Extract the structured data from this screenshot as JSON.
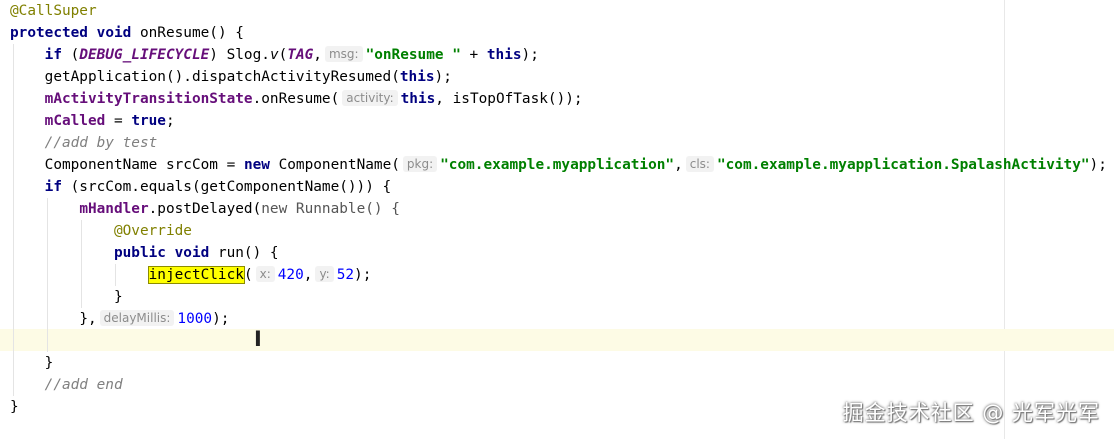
{
  "editor": {
    "watermark": "掘金技术社区 @ 光军光军",
    "lines": {
      "l01": {
        "annotation": "@CallSuper"
      },
      "l02": {
        "kw_protected": "protected",
        "kw_void": "void",
        "method_decl": " onResume() {"
      },
      "l03": {
        "kw_if": "if",
        "open": " (",
        "const": "DEBUG_LIFECYCLE",
        "mid": ") Slog.",
        "v": "v",
        "paren": "(",
        "tag": "TAG",
        "comma": ",",
        "hint": "msg:",
        "str": "\"onResume \"",
        "plus": " + ",
        "kw_this": "this",
        "close": ");"
      },
      "l04": {
        "code": "getApplication().dispatchActivityResumed(",
        "kw_this": "this",
        "close": ");"
      },
      "l05": {
        "field": "mActivityTransitionState",
        "code": ".onResume(",
        "hint": "activity:",
        "kw_this": "this",
        "rest": ", isTopOfTask());"
      },
      "l06": {
        "field": "mCalled",
        "eq": " = ",
        "kw_true": "true",
        "semi": ";"
      },
      "l07": {
        "comment": "//add by test"
      },
      "l08": {
        "code": "ComponentName srcCom = ",
        "kw_new": "new",
        "ctor": " ComponentName(",
        "hint_pkg": "pkg:",
        "str_pkg": "\"com.example.myapplication\"",
        "comma": ",",
        "hint_cls": "cls:",
        "str_cls": "\"com.example.myapplication.SpalashActivity\"",
        "close": ");"
      },
      "l09": {
        "kw_if": "if",
        "code": " (srcCom.equals(getComponentName())) {"
      },
      "l10": {
        "field": "mHandler",
        "code": ".postDelayed(",
        "muted_new": "new",
        "muted_rest": " Runnable() {"
      },
      "l11": {
        "annotation": "@Override"
      },
      "l12": {
        "kw_public": "public",
        "kw_void": "void",
        "code": " run() {"
      },
      "l13": {
        "call": "injectClick",
        "paren": "(",
        "hint_x": "x:",
        "num_x": "420",
        "comma": ",",
        "hint_y": "y:",
        "num_y": "52",
        "close": ");"
      },
      "l14": {
        "code": "}"
      },
      "l15": {
        "code": "},",
        "hint": "delayMillis:",
        "num": "1000",
        "close": ");"
      },
      "l16": {
        "code": ""
      },
      "l17": {
        "code": "}"
      },
      "l18": {
        "comment": "//add end"
      },
      "l19": {
        "code": "}"
      }
    },
    "colors": {
      "keyword": "#000080",
      "string": "#008000",
      "number": "#0000ff",
      "annotation": "#808000",
      "field": "#660e7a",
      "comment": "#808080",
      "search_highlight": "#ffff00",
      "current_line": "#fdfbe5"
    }
  }
}
